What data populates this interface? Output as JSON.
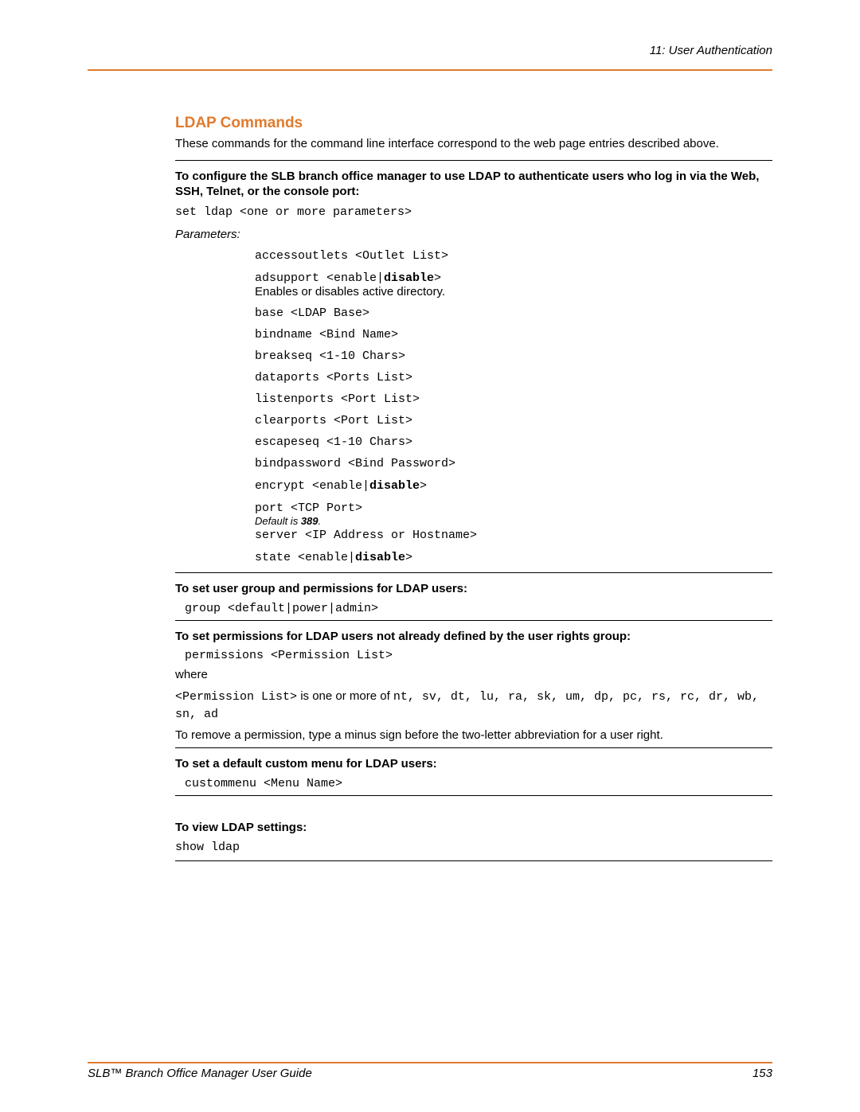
{
  "header": {
    "running": "11: User Authentication"
  },
  "title": "LDAP Commands",
  "intro": "These commands for the command line interface correspond to the web page entries described above.",
  "instr1": "To configure the SLB branch office manager to use LDAP to authenticate users who log in via the Web, SSH, Telnet, or the console port:",
  "cmd1": "set ldap <one or more parameters>",
  "params_label": "Parameters:",
  "params": {
    "accessoutlets": "accessoutlets <Outlet List>",
    "adsupport_pre": "adsupport <enable|",
    "adsupport_bold": "disable",
    "adsupport_post": ">",
    "adsupport_note": "Enables or disables active directory.",
    "base": "base <LDAP Base>",
    "bindname": "bindname <Bind Name>",
    "breakseq": "breakseq <1-10 Chars>",
    "dataports": "dataports <Ports List>",
    "listenports": "listenports <Port List>",
    "clearports": "clearports <Port List>",
    "escapeseq": "escapeseq <1-10 Chars>",
    "bindpassword": "bindpassword <Bind Password>",
    "encrypt_pre": "encrypt <enable|",
    "encrypt_bold": "disable",
    "encrypt_post": ">",
    "port": "port <TCP Port>",
    "port_note_pre": "Default is ",
    "port_note_bold": "389",
    "port_note_post": ".",
    "server": "server <IP Address or Hostname>",
    "state_pre": "state <enable|",
    "state_bold": "disable",
    "state_post": ">"
  },
  "sec2": {
    "title": "To set user group and permissions for LDAP users:",
    "cmd": "group <default|power|admin>"
  },
  "sec3": {
    "title": "To set permissions for LDAP users not already defined by the user rights group:",
    "cmd": "permissions <Permission List>",
    "where": "where",
    "pl_label": "<Permission List>",
    "pl_mid": " is one or more of ",
    "pl_codes": "nt, sv, dt, lu, ra, sk, um, dp, pc, rs, rc, dr, wb, sn, ad",
    "remove": "To remove a permission, type a minus sign before the two-letter abbreviation for a user right."
  },
  "sec4": {
    "title": "To set a default custom menu for LDAP users:",
    "cmd": "custommenu <Menu Name>"
  },
  "sec5": {
    "title": "To view LDAP settings:",
    "cmd": "show ldap"
  },
  "footer": {
    "title": "SLB™ Branch Office Manager User Guide",
    "page": "153"
  }
}
